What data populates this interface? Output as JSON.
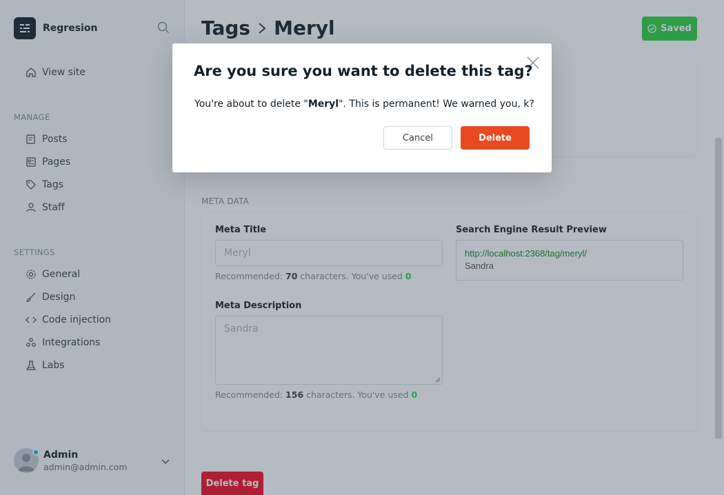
{
  "sidebar": {
    "brand_name": "Regresion",
    "view_site": "View site",
    "manage_heading": "MANAGE",
    "manage_items": [
      {
        "label": "Posts",
        "icon": "posts-icon"
      },
      {
        "label": "Pages",
        "icon": "pages-icon"
      },
      {
        "label": "Tags",
        "icon": "tag-icon"
      },
      {
        "label": "Staff",
        "icon": "staff-icon"
      }
    ],
    "settings_heading": "SETTINGS",
    "settings_items": [
      {
        "label": "General",
        "icon": "gear-icon"
      },
      {
        "label": "Design",
        "icon": "brush-icon"
      },
      {
        "label": "Code injection",
        "icon": "code-icon"
      },
      {
        "label": "Integrations",
        "icon": "integrations-icon"
      },
      {
        "label": "Labs",
        "icon": "flask-icon"
      }
    ],
    "user": {
      "name": "Admin",
      "email": "admin@admin.com"
    }
  },
  "header": {
    "breadcrumb_parent": "Tags",
    "breadcrumb_current": "Meryl",
    "saved_label": "Saved"
  },
  "meta": {
    "section_label": "META DATA",
    "title_label": "Meta Title",
    "title_placeholder": "Meryl",
    "title_hint_prefix": "Recommended: ",
    "title_hint_count": "70",
    "title_hint_suffix": " characters. You've used ",
    "title_hint_used": "0",
    "desc_label": "Meta Description",
    "desc_placeholder": "Sandra",
    "desc_hint_prefix": "Recommended: ",
    "desc_hint_count": "156",
    "desc_hint_suffix": " characters. You've used ",
    "desc_hint_used": "0",
    "serp_label": "Search Engine Result Preview",
    "serp_url": "http://localhost:2368/tag/meryl/",
    "serp_desc": "Sandra"
  },
  "delete_tag_label": "Delete tag",
  "modal": {
    "title": "Are you sure you want to delete this tag?",
    "body_prefix": "You're about to delete \"",
    "body_name": "Meryl",
    "body_suffix": "\". This is permanent! We warned you, k?",
    "cancel_label": "Cancel",
    "delete_label": "Delete"
  },
  "colors": {
    "accent_green": "#30cf43",
    "danger_red": "#e84a1f",
    "overlay": "rgba(48,66,84,0.36)"
  }
}
